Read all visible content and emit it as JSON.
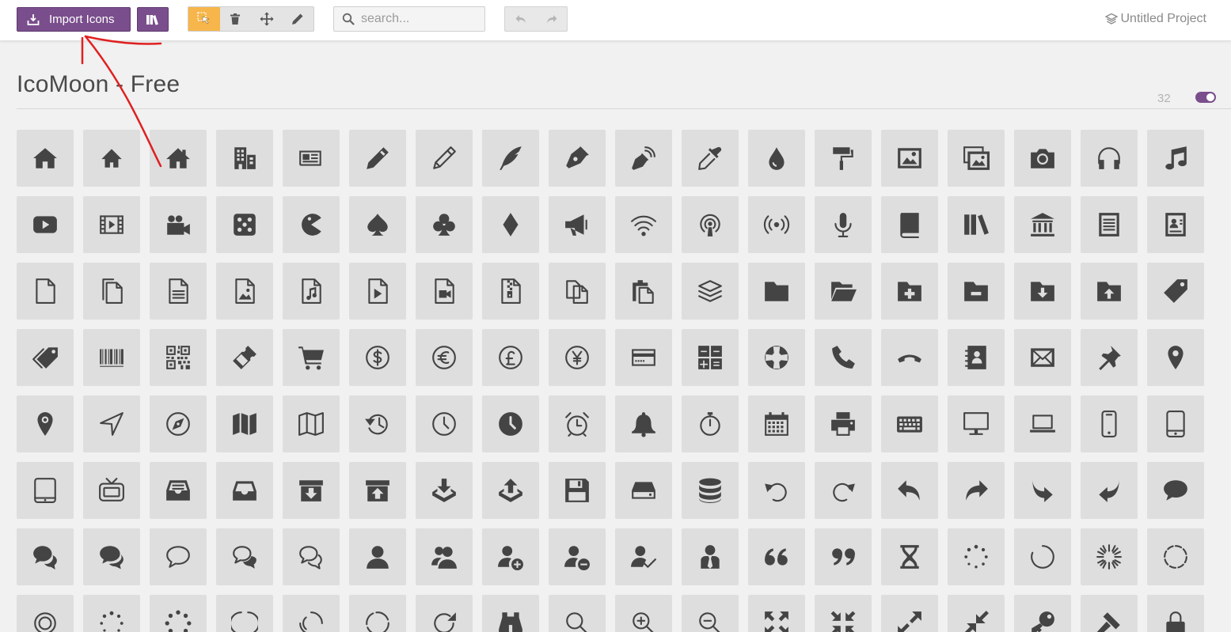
{
  "toolbar": {
    "import_label": "Import Icons",
    "search_placeholder": "search...",
    "project_title": "Untitled Project"
  },
  "colors": {
    "accent": "#7a4e8c",
    "active_tool": "#f7b64b",
    "annotation": "#e02020"
  },
  "icon_set": {
    "title": "IcoMoon - Free",
    "count": "32"
  },
  "icons": [
    "home",
    "home2",
    "home3",
    "office",
    "newspaper",
    "pencil",
    "pencil2",
    "quill",
    "pen",
    "blog",
    "eyedropper",
    "droplet",
    "paint-format",
    "image",
    "images",
    "camera",
    "headphones",
    "music",
    "play",
    "film",
    "video-camera",
    "dice",
    "pacman",
    "spades",
    "clubs",
    "diamonds",
    "bullhorn",
    "connection",
    "podcast",
    "feed",
    "mic",
    "book",
    "books",
    "library",
    "file-text",
    "profile",
    "file-empty",
    "files-empty",
    "file-text2",
    "file-picture",
    "file-music",
    "file-play",
    "file-video",
    "file-zip",
    "copy",
    "paste",
    "stack",
    "folder",
    "folder-open",
    "folder-plus",
    "folder-minus",
    "folder-download",
    "folder-upload",
    "price-tag",
    "price-tags",
    "barcode",
    "qrcode",
    "ticket",
    "cart",
    "coin-dollar",
    "coin-euro",
    "coin-pound",
    "coin-yen",
    "credit-card",
    "calculator",
    "lifebuoy",
    "phone",
    "phone-hang-up",
    "address-book",
    "envelop",
    "pushpin",
    "location",
    "location2",
    "compass",
    "compass2",
    "map",
    "map2",
    "history",
    "clock",
    "clock2",
    "alarm",
    "bell",
    "stopwatch",
    "calendar",
    "printer",
    "keyboard",
    "display",
    "laptop",
    "mobile",
    "mobile2",
    "tablet",
    "tv",
    "drawer",
    "drawer2",
    "box-add",
    "box-remove",
    "download",
    "upload",
    "floppy-disk",
    "drive",
    "database",
    "undo",
    "redo",
    "undo2",
    "redo2",
    "forward",
    "reply",
    "bubble",
    "bubbles",
    "bubbles2",
    "bubble2",
    "bubbles3",
    "bubbles4",
    "user",
    "users",
    "user-plus",
    "user-minus",
    "user-check",
    "user-tie",
    "quotes-left",
    "quotes-right",
    "hour-glass",
    "spinner",
    "spinner2",
    "spinner3",
    "spinner4",
    "spinner5",
    "spinner6",
    "spinner7",
    "spinner8",
    "spinner9",
    "spinner10",
    "spinner11",
    "binoculars",
    "search",
    "zoom-in",
    "zoom-out",
    "enlarge",
    "shrink",
    "enlarge2",
    "shrink2",
    "key",
    "hammer",
    "lock"
  ]
}
